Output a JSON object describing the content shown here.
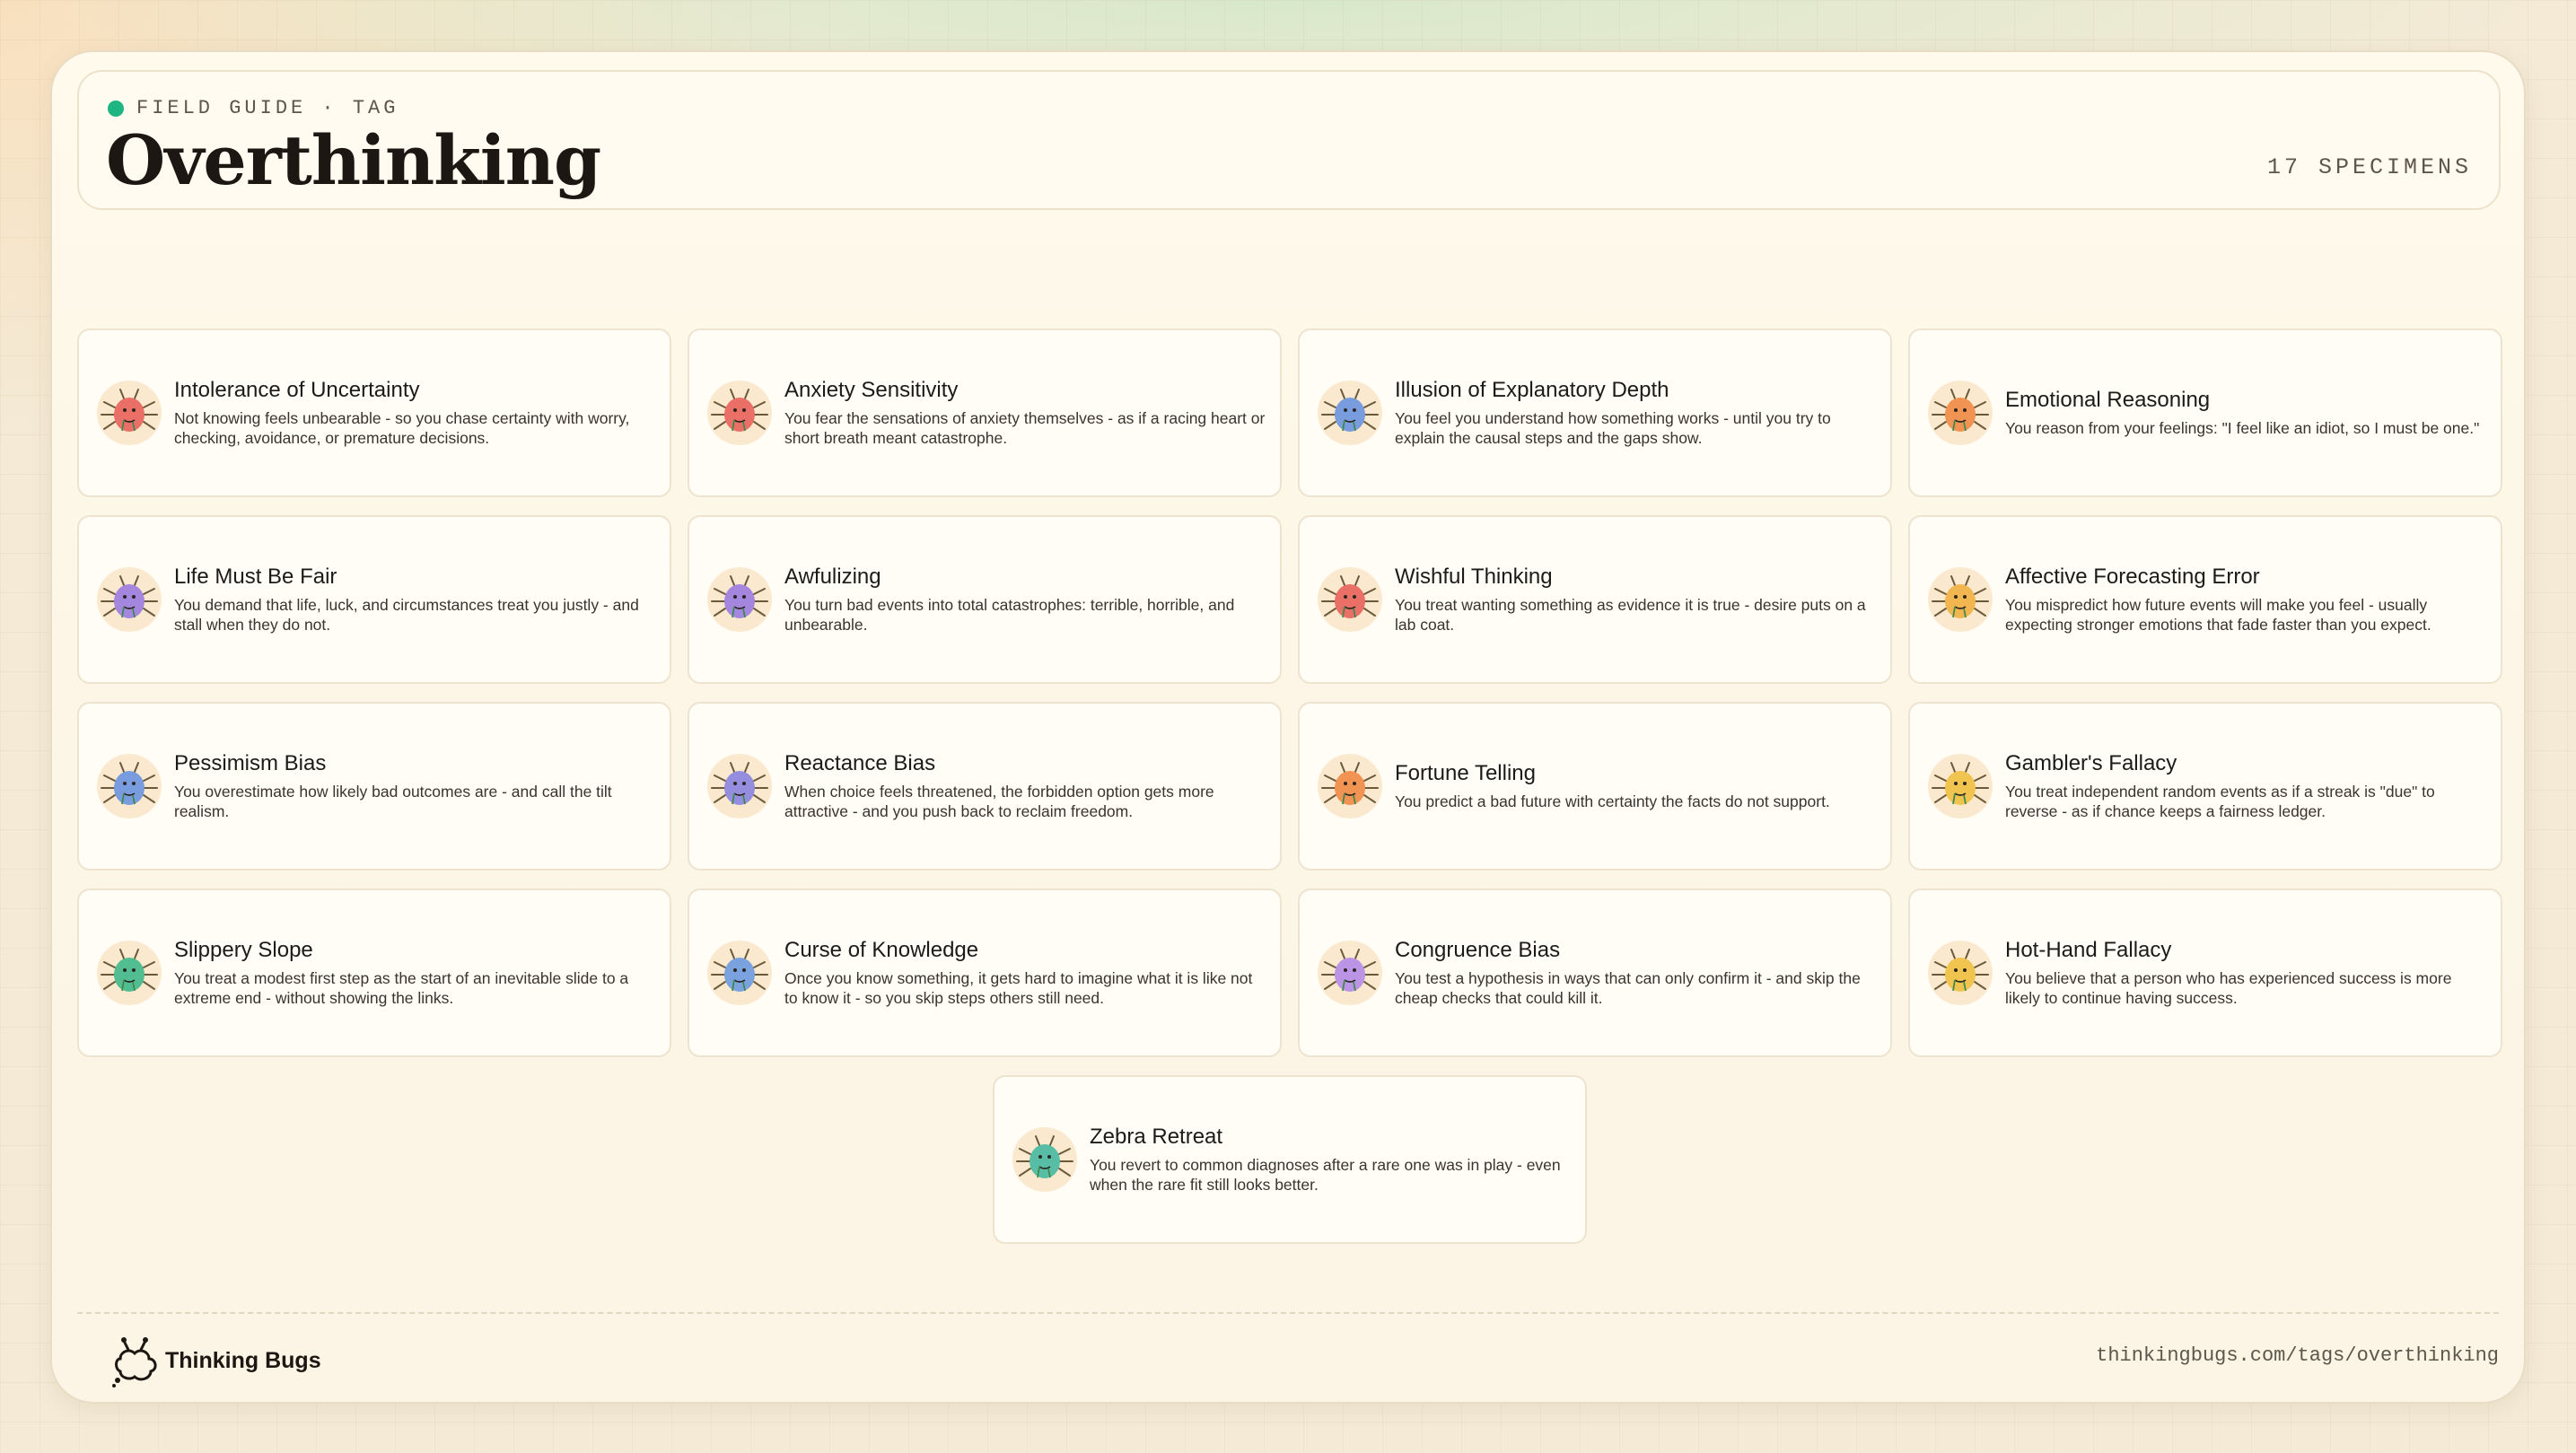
{
  "header": {
    "eyebrow": "FIELD GUIDE · TAG",
    "title": "Overthinking",
    "count": "17 SPECIMENS",
    "accent": "#1fb582"
  },
  "cards": [
    {
      "name": "Intolerance of Uncertainty",
      "desc": "Not knowing feels unbearable - so you chase certainty with worry, checking, avoidance, or premature decisions.",
      "icon": "bug-icon",
      "color": "#e8625a"
    },
    {
      "name": "Anxiety Sensitivity",
      "desc": "You fear the sensations of anxiety themselves - as if a racing heart or short breath meant catastrophe.",
      "icon": "bug-icon",
      "color": "#e8625a"
    },
    {
      "name": "Illusion of Explanatory Depth",
      "desc": "You feel you understand how something works - until you try to explain the causal steps and the gaps show.",
      "icon": "bug-icon",
      "color": "#6a93e0"
    },
    {
      "name": "Emotional Reasoning",
      "desc": "You reason from your feelings: \"I feel like an idiot, so I must be one.\"",
      "icon": "bug-icon",
      "color": "#f08a45"
    },
    {
      "name": "Life Must Be Fair",
      "desc": "You demand that life, luck, and circumstances treat you justly - and stall when they do not.",
      "icon": "bug-icon",
      "color": "#9b7be0"
    },
    {
      "name": "Awfulizing",
      "desc": "You turn bad events into total catastrophes: terrible, horrible, and unbearable.",
      "icon": "bug-icon",
      "color": "#9b7be0"
    },
    {
      "name": "Wishful Thinking",
      "desc": "You treat wanting something as evidence it is true - desire puts on a lab coat.",
      "icon": "bug-icon",
      "color": "#e8625a"
    },
    {
      "name": "Affective Forecasting Error",
      "desc": "You mispredict how future events will make you feel - usually expecting stronger emotions that fade faster than you expect.",
      "icon": "bug-icon",
      "color": "#f0b040"
    },
    {
      "name": "Pessimism Bias",
      "desc": "You overestimate how likely bad outcomes are - and call the tilt realism.",
      "icon": "bug-icon",
      "color": "#6a93e0"
    },
    {
      "name": "Reactance Bias",
      "desc": "When choice feels threatened, the forbidden option gets more attractive - and you push back to reclaim freedom.",
      "icon": "bug-icon",
      "color": "#8a84e0"
    },
    {
      "name": "Fortune Telling",
      "desc": "You predict a bad future with certainty the facts do not support.",
      "icon": "bug-icon",
      "color": "#f08a45"
    },
    {
      "name": "Gambler's Fallacy",
      "desc": "You treat independent random events as if a streak is \"due\" to reverse - as if chance keeps a fairness ledger.",
      "icon": "bug-icon",
      "color": "#f0c040"
    },
    {
      "name": "Slippery Slope",
      "desc": "You treat a modest first step as the start of an inevitable slide to a extreme end - without showing the links.",
      "icon": "bug-icon",
      "color": "#3fb888"
    },
    {
      "name": "Curse of Knowledge",
      "desc": "Once you know something, it gets hard to imagine what it is like not to know it - so you skip steps others still need.",
      "icon": "bug-icon",
      "color": "#6a9ae0"
    },
    {
      "name": "Congruence Bias",
      "desc": "You test a hypothesis in ways that can only confirm it - and skip the cheap checks that could kill it.",
      "icon": "bug-icon",
      "color": "#b48be8"
    },
    {
      "name": "Hot-Hand Fallacy",
      "desc": "You believe that a person who has experienced success is more likely to continue having success.",
      "icon": "bug-icon",
      "color": "#f0c040"
    },
    {
      "name": "Zebra Retreat",
      "desc": "You revert to common diagnoses after a rare one was in play - even when the rare fit still looks better.",
      "icon": "bug-icon",
      "color": "#45b8a0"
    }
  ],
  "footer": {
    "brand": "Thinking Bugs",
    "logo_icon": "thinking-bugs-logo-icon",
    "url": "thinkingbugs.com/tags/overthinking"
  }
}
